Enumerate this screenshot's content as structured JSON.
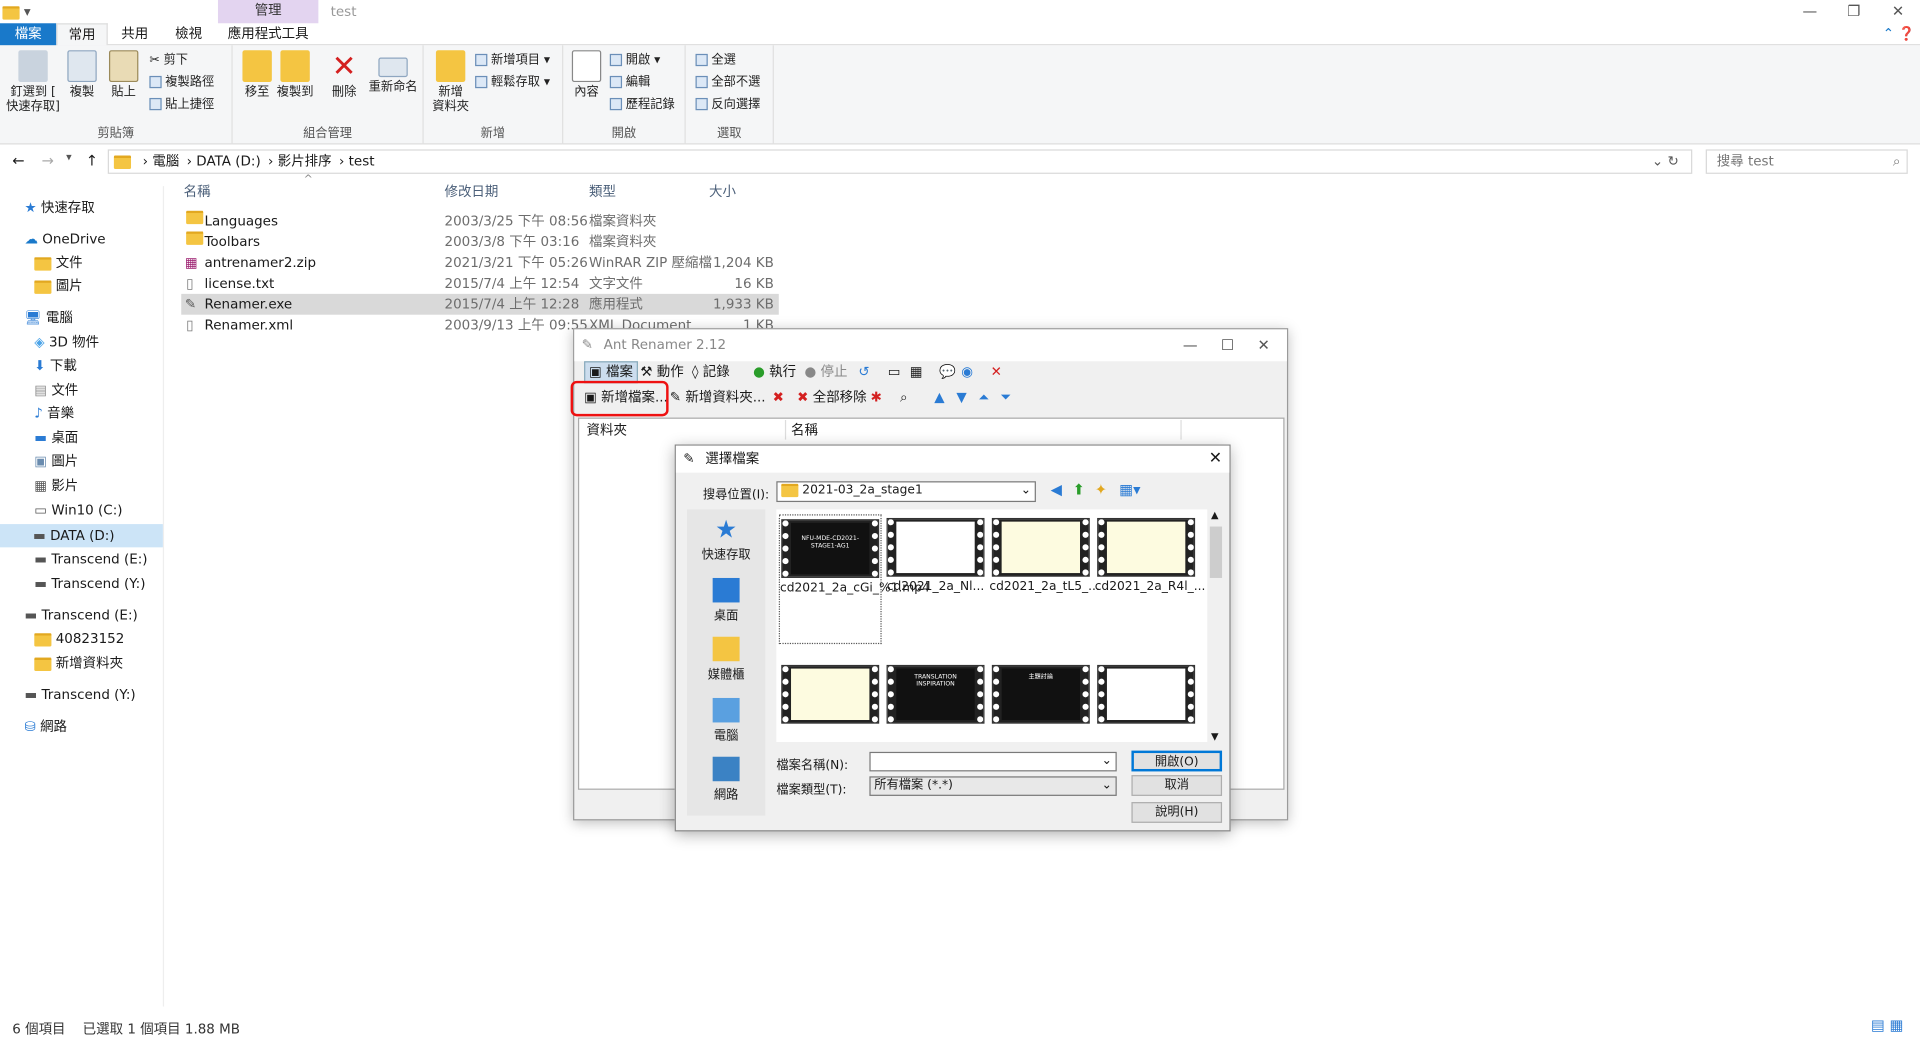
{
  "window": {
    "title": "test",
    "context_tab": "管理"
  },
  "ribbon": {
    "tabs": [
      "檔案",
      "常用",
      "共用",
      "檢視",
      "應用程式工具"
    ],
    "clipboard": {
      "pin": "釘選到 [\n快速存取]",
      "copy": "複製",
      "paste": "貼上",
      "cut": "剪下",
      "copy_path": "複製路徑",
      "paste_shortcut": "貼上捷徑",
      "label": "剪貼簿"
    },
    "organize": {
      "move": "移至",
      "copy_to": "複製到",
      "delete": "刪除",
      "rename": "重新命名",
      "label": "組合管理"
    },
    "new": {
      "new_folder": "新增\n資料夾",
      "new_item": "新增項目 ▾",
      "easy_access": "輕鬆存取 ▾",
      "label": "新增"
    },
    "open": {
      "properties": "內容",
      "open": "開啟 ▾",
      "edit": "編輯",
      "history": "歷程記錄",
      "label": "開啟"
    },
    "select": {
      "all": "全選",
      "none": "全部不選",
      "invert": "反向選擇",
      "label": "選取"
    }
  },
  "address": {
    "parts": [
      "電腦",
      "DATA (D:)",
      "影片排序",
      "test"
    ],
    "search_placeholder": "搜尋 test"
  },
  "nav": [
    {
      "label": "快速存取"
    },
    {
      "label": "OneDrive"
    },
    {
      "label": "文件"
    },
    {
      "label": "圖片"
    },
    {
      "label": "電腦"
    },
    {
      "label": "3D 物件"
    },
    {
      "label": "下載"
    },
    {
      "label": "文件"
    },
    {
      "label": "音樂"
    },
    {
      "label": "桌面"
    },
    {
      "label": "圖片"
    },
    {
      "label": "影片"
    },
    {
      "label": "Win10 (C:)"
    },
    {
      "label": "DATA (D:)"
    },
    {
      "label": "Transcend (E:)"
    },
    {
      "label": "Transcend (Y:)"
    },
    {
      "label": "Transcend (E:)"
    },
    {
      "label": "40823152"
    },
    {
      "label": "新增資料夾"
    },
    {
      "label": "Transcend (Y:)"
    },
    {
      "label": "網路"
    }
  ],
  "columns": [
    "名稱",
    "修改日期",
    "類型",
    "大小"
  ],
  "files": [
    {
      "name": "Languages",
      "date": "2003/3/25 下午 08:56",
      "type": "檔案資料夾",
      "size": ""
    },
    {
      "name": "Toolbars",
      "date": "2003/3/8 下午 03:16",
      "type": "檔案資料夾",
      "size": ""
    },
    {
      "name": "antrenamer2.zip",
      "date": "2021/3/21 下午 05:26",
      "type": "WinRAR ZIP 壓縮檔",
      "size": "1,204 KB"
    },
    {
      "name": "license.txt",
      "date": "2015/7/4 上午 12:54",
      "type": "文字文件",
      "size": "16 KB"
    },
    {
      "name": "Renamer.exe",
      "date": "2015/7/4 上午 12:28",
      "type": "應用程式",
      "size": "1,933 KB"
    },
    {
      "name": "Renamer.xml",
      "date": "2003/9/13 上午 09:55",
      "type": "XML Document",
      "size": "1 KB"
    }
  ],
  "status": {
    "count": "6 個項目",
    "selected": "已選取 1 個項目  1.88 MB"
  },
  "ant": {
    "title": "Ant Renamer 2.12",
    "menu": {
      "files": "檔案",
      "actions": "動作",
      "log": "記錄",
      "go": "執行",
      "stop": "停止"
    },
    "toolbar": {
      "add_files": "新增檔案...",
      "add_folders": "新增資料夾...",
      "remove_all": "全部移除"
    },
    "columns": {
      "folder": "資料夾",
      "name": "名稱"
    }
  },
  "dialog": {
    "title": "選擇檔案",
    "look_in_label": "搜尋位置(I):",
    "look_in_value": "2021-03_2a_stage1",
    "places": [
      "快速存取",
      "桌面",
      "媒體櫃",
      "電腦",
      "網路"
    ],
    "thumbs": [
      {
        "label": "cd2021_2a_cGi_%1.mp4",
        "caption": "NFU-MDE-CD2021-STAGE1-AG1"
      },
      {
        "label": "cd2021_2a_Nl...",
        "caption": ""
      },
      {
        "label": "cd2021_2a_tL5_...",
        "caption": ""
      },
      {
        "label": "cd2021_2a_R4l_...",
        "caption": ""
      },
      {
        "label": "",
        "caption": ""
      },
      {
        "label": "",
        "caption": "TRANSLATION INSPIRATION"
      },
      {
        "label": "",
        "caption": "主題討論"
      },
      {
        "label": "",
        "caption": ""
      }
    ],
    "filename_label": "檔案名稱(N):",
    "filetype_label": "檔案類型(T):",
    "filetype_value": "所有檔案 (*.*)",
    "open": "開啟(O)",
    "cancel": "取消",
    "help": "說明(H)"
  }
}
